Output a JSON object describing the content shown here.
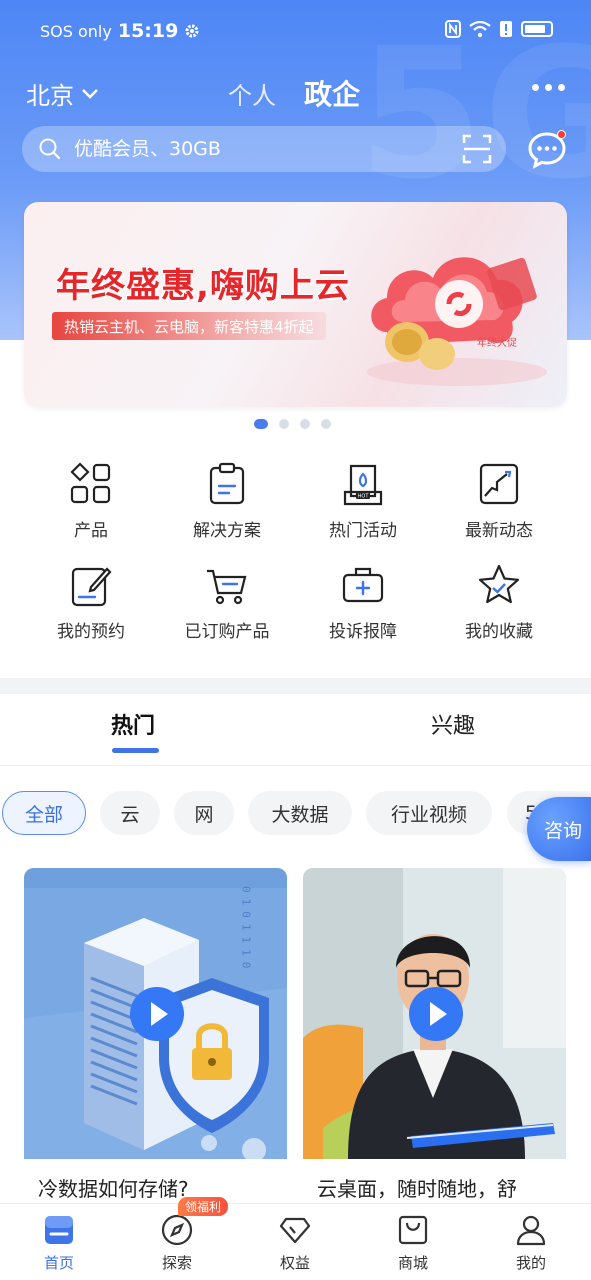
{
  "status_bar": {
    "sos": "SOS only",
    "time": "15:19"
  },
  "top_nav": {
    "city": "北京",
    "tab_personal": "个人",
    "tab_enterprise": "政企"
  },
  "search": {
    "placeholder": "优酷会员、30GB"
  },
  "banner": {
    "title": "年终盛惠,嗨购上云",
    "subtitle": "热销云主机、云电脑，新客特惠4折起",
    "badge_text": "年终大促"
  },
  "carousel": {
    "count": 4,
    "active_index": 0
  },
  "quick_menu": [
    {
      "label": "产品",
      "icon": "grid-icon"
    },
    {
      "label": "解决方案",
      "icon": "clipboard-icon"
    },
    {
      "label": "热门活动",
      "icon": "hot-activity-icon"
    },
    {
      "label": "最新动态",
      "icon": "trend-icon"
    },
    {
      "label": "我的预约",
      "icon": "edit-note-icon"
    },
    {
      "label": "已订购产品",
      "icon": "cart-icon"
    },
    {
      "label": "投诉报障",
      "icon": "toolbox-icon"
    },
    {
      "label": "我的收藏",
      "icon": "star-icon"
    }
  ],
  "feed_tabs": {
    "hot": "热门",
    "interest": "兴趣"
  },
  "chips": [
    "全部",
    "云",
    "网",
    "大数据",
    "行业视频",
    "5G"
  ],
  "consult": "咨询",
  "cards": [
    {
      "title": "冷数据如何存储?",
      "binary": "0101110"
    },
    {
      "title": "云桌面，随时随地，舒"
    }
  ],
  "bottom_nav": {
    "items": [
      {
        "label": "首页",
        "icon": "home-icon",
        "active": true
      },
      {
        "label": "探索",
        "icon": "compass-icon",
        "active": false
      },
      {
        "label": "权益",
        "icon": "diamond-icon",
        "active": false
      },
      {
        "label": "商城",
        "icon": "shopping-bag-icon",
        "active": false
      },
      {
        "label": "我的",
        "icon": "user-icon",
        "active": false
      }
    ],
    "explore_badge": "领福利"
  },
  "colors": {
    "brand_blue": "#3f73ea",
    "header_blue": "#4d86f5",
    "accent_red": "#e5262a"
  }
}
